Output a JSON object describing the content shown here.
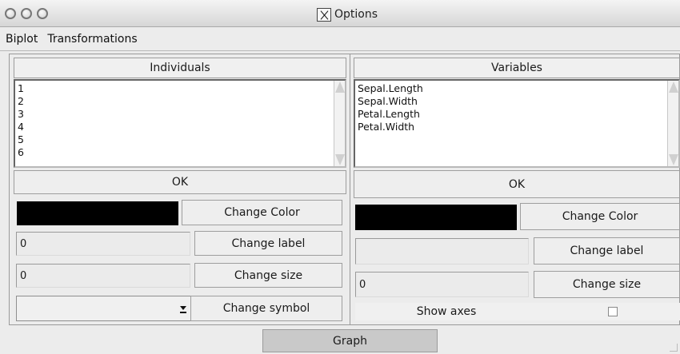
{
  "window": {
    "title": "Options"
  },
  "menu": [
    {
      "label": "Biplot"
    },
    {
      "label": "Transformations"
    }
  ],
  "individuals": {
    "header": "Individuals",
    "items": [
      "1",
      "2",
      "3",
      "4",
      "5",
      "6"
    ],
    "ok_label": "OK",
    "color": "#000000",
    "change_color_label": "Change Color",
    "label_value": "0",
    "change_label_label": "Change label",
    "size_value": "0",
    "change_size_label": "Change size",
    "symbol_value": "",
    "change_symbol_label": "Change symbol"
  },
  "variables": {
    "header": "Variables",
    "items": [
      "Sepal.Length",
      "Sepal.Width",
      "Petal.Length",
      "Petal.Width"
    ],
    "ok_label": "OK",
    "color": "#000000",
    "change_color_label": "Change Color",
    "label_value": "",
    "change_label_label": "Change label",
    "size_value": "0",
    "change_size_label": "Change size",
    "show_axes_label": "Show axes",
    "show_axes_checked": false
  },
  "graph_label": "Graph"
}
